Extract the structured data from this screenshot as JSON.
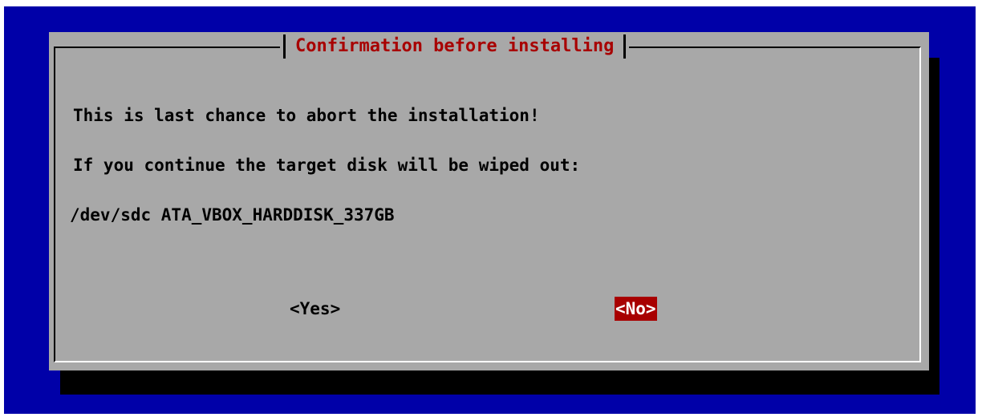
{
  "dialog": {
    "title": "Confirmation before installing",
    "lines": [
      "This is last chance to abort the installation!",
      "If you continue the target disk will be wiped out:",
      "/dev/sdc ATA_VBOX_HARDDISK_337GB"
    ],
    "buttons": {
      "yes_label": "<Yes>",
      "no_label": "<No>",
      "selected": "no"
    }
  },
  "colors": {
    "screen_background": "#0000a8",
    "dialog_background": "#a8a8a8",
    "title_text": "#a80000",
    "selected_button_background": "#a80000",
    "selected_button_text": "#ffffff"
  }
}
